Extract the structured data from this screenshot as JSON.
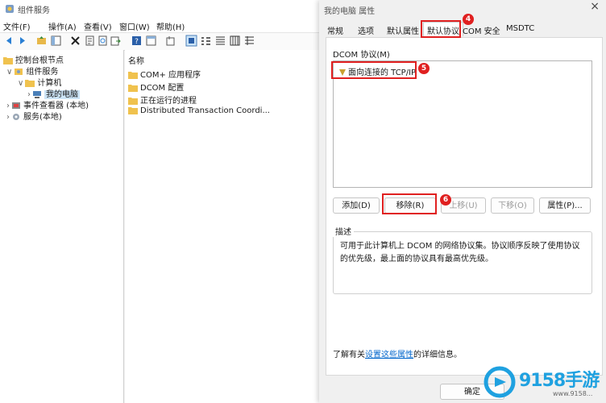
{
  "mmc": {
    "title": "组件服务",
    "menu": [
      "文件(F)",
      "操作(A)",
      "查看(V)",
      "窗口(W)",
      "帮助(H)"
    ],
    "tree": {
      "root": "控制台根节点",
      "component_services": "组件服务",
      "computers": "计算机",
      "my_computer": "我的电脑",
      "event_viewer": "事件查看器 (本地)",
      "services": "服务(本地)"
    },
    "list": {
      "header": "名称",
      "items": [
        "COM+ 应用程序",
        "DCOM 配置",
        "正在运行的进程",
        "Distributed Transaction Coordi..."
      ]
    }
  },
  "dialog": {
    "title": "我的电脑 属性",
    "close_glyph": "×",
    "tabs": [
      "常规",
      "选项",
      "默认属性",
      "默认协议",
      "COM 安全",
      "MSDTC"
    ],
    "active_tab": "默认协议",
    "protocols_label": "DCOM 协议(M)",
    "protocols": [
      "面向连接的 TCP/IP"
    ],
    "buttons": {
      "add": "添加(D)",
      "remove": "移除(R)",
      "move_up": "上移(U)",
      "move_down": "下移(O)",
      "properties": "属性(P)..."
    },
    "description_title": "描述",
    "description_text": "可用于此计算机上 DCOM 的网络协议集。协议顺序反映了使用协议的优先级，最上面的协议具有最高优先级。",
    "info_prefix": "了解有关",
    "info_link": "设置这些属性",
    "info_suffix": "的详细信息。",
    "ok": "确定"
  },
  "annotations": [
    "4",
    "5",
    "6"
  ],
  "watermark": {
    "brand": "9158手游",
    "url": "www.9158..."
  },
  "colors": {
    "annotation_red": "#e02020",
    "link_blue": "#0066cc",
    "selection": "#cce4f7",
    "watermark_blue": "#1fa1e0"
  }
}
